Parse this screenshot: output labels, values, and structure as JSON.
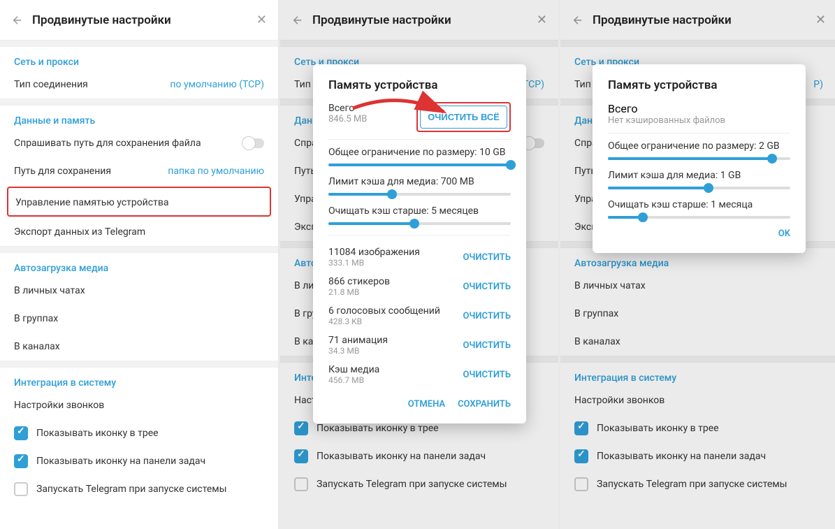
{
  "panel": {
    "title": "Продвинутые настройки",
    "net_hdr": "Сеть и прокси",
    "conn_lbl": "Тип соединения",
    "conn_val": "по умолчанию (TCP)",
    "data_hdr": "Данные и память",
    "ask_path": "Спрашивать путь для сохранения файла",
    "save_path_lbl": "Путь для сохранения",
    "save_path_val": "папка по умолчанию",
    "manage_mem": "Управление памятью устройства",
    "export": "Экспорт данных из Telegram",
    "media_hdr": "Автозагрузка медиа",
    "media_pm": "В личных чатах",
    "media_grp": "В группах",
    "media_ch": "В каналах",
    "sys_hdr": "Интеграция в систему",
    "calls": "Настройки звонков",
    "tray": "Показывать иконку в трее",
    "taskbar": "Показывать иконку на панели задач",
    "autostart": "Запускать Telegram при запуске системы"
  },
  "modal2": {
    "title": "Память устройства",
    "total_lbl": "Всего",
    "total_sz": "846.5 MB",
    "clear_all": "ОЧИСТИТЬ ВСЁ",
    "limit_size": "Общее ограничение по размеру: 10 GB",
    "limit_media": "Лимит кэша для медиа: 700 MB",
    "limit_age": "Очищать кэш старше: 5 месяцев",
    "cats": [
      {
        "lbl": "11084 изображения",
        "sz": "333.1 MB",
        "btn": "ОЧИСТИТЬ"
      },
      {
        "lbl": "866 стикеров",
        "sz": "21.8 MB",
        "btn": "ОЧИСТИТЬ"
      },
      {
        "lbl": "6 голосовых сообщений",
        "sz": "428.3 KB",
        "btn": "ОЧИСТИТЬ"
      },
      {
        "lbl": "71 анимация",
        "sz": "34.3 MB",
        "btn": "ОЧИСТИТЬ"
      },
      {
        "lbl": "Кэш медиа",
        "sz": "456.7 MB",
        "btn": "ОЧИСТИТЬ"
      }
    ],
    "cancel": "ОТМЕНА",
    "save": "СОХРАНИТЬ",
    "sliders": [
      100,
      35,
      47
    ]
  },
  "modal3": {
    "title": "Память устройства",
    "total_lbl": "Всего",
    "no_cache": "Нет кэшированных файлов",
    "limit_size": "Общее ограничение по размеру: 2 GB",
    "limit_media": "Лимит кэша для медиа: 1 GB",
    "limit_age": "Очищать кэш старше: 1 месяца",
    "ok": "OK",
    "sliders": [
      90,
      55,
      19
    ]
  }
}
